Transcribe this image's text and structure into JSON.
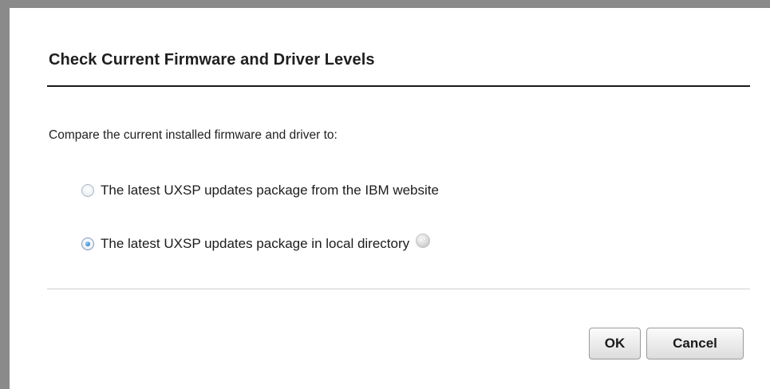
{
  "dialog": {
    "title": "Check Current Firmware and Driver Levels",
    "prompt": "Compare the current installed firmware and driver to:",
    "options": [
      {
        "label": "The latest UXSP updates package from the IBM website",
        "selected": false
      },
      {
        "label": "The latest UXSP updates package in local directory",
        "selected": true,
        "help_icon": "question-icon"
      }
    ],
    "help_glyph": "?",
    "buttons": {
      "ok_label": "OK",
      "cancel_label": "Cancel"
    }
  },
  "colors": {
    "frame": "#8a8a8a",
    "title_rule": "#1a1a1a",
    "radio_selected": "#3b8fd6",
    "footer_rule": "#d0d0d0"
  }
}
